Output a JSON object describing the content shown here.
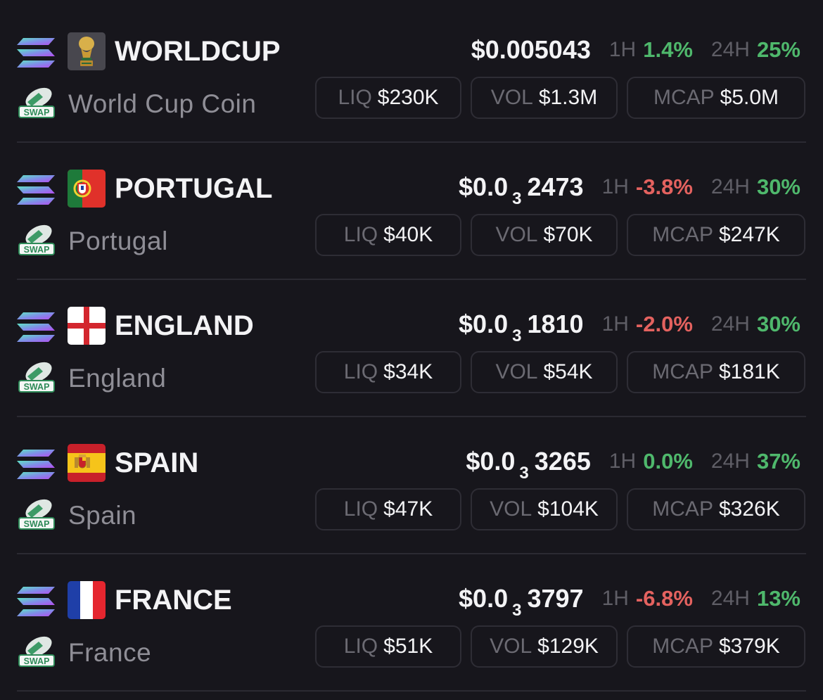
{
  "tokens": [
    {
      "symbol": "WORLDCUP",
      "name": "World Cup Coin",
      "flag": "trophy-icon",
      "price_prefix": "$0.005043",
      "price_zeros": "",
      "price_digits": "",
      "h1_label": "1H",
      "h1": "1.4%",
      "h1_dir": "up",
      "h24_label": "24H",
      "h24": "25%",
      "h24_dir": "up",
      "liq_label": "LIQ",
      "liq": "$230K",
      "vol_label": "VOL",
      "vol": "$1.3M",
      "mcap_label": "MCAP",
      "mcap": "$5.0M"
    },
    {
      "symbol": "PORTUGAL",
      "name": "Portugal",
      "flag": "portugal-flag-icon",
      "price_prefix": "$0.0",
      "price_zeros": "3",
      "price_digits": "2473",
      "h1_label": "1H",
      "h1": "-3.8%",
      "h1_dir": "down",
      "h24_label": "24H",
      "h24": "30%",
      "h24_dir": "up",
      "liq_label": "LIQ",
      "liq": "$40K",
      "vol_label": "VOL",
      "vol": "$70K",
      "mcap_label": "MCAP",
      "mcap": "$247K"
    },
    {
      "symbol": "ENGLAND",
      "name": "England",
      "flag": "england-flag-icon",
      "price_prefix": "$0.0",
      "price_zeros": "3",
      "price_digits": "1810",
      "h1_label": "1H",
      "h1": "-2.0%",
      "h1_dir": "down",
      "h24_label": "24H",
      "h24": "30%",
      "h24_dir": "up",
      "liq_label": "LIQ",
      "liq": "$34K",
      "vol_label": "VOL",
      "vol": "$54K",
      "mcap_label": "MCAP",
      "mcap": "$181K"
    },
    {
      "symbol": "SPAIN",
      "name": "Spain",
      "flag": "spain-flag-icon",
      "price_prefix": "$0.0",
      "price_zeros": "3",
      "price_digits": "3265",
      "h1_label": "1H",
      "h1": "0.0%",
      "h1_dir": "up",
      "h24_label": "24H",
      "h24": "37%",
      "h24_dir": "up",
      "liq_label": "LIQ",
      "liq": "$47K",
      "vol_label": "VOL",
      "vol": "$104K",
      "mcap_label": "MCAP",
      "mcap": "$326K"
    },
    {
      "symbol": "FRANCE",
      "name": "France",
      "flag": "france-flag-icon",
      "price_prefix": "$0.0",
      "price_zeros": "3",
      "price_digits": "3797",
      "h1_label": "1H",
      "h1": "-6.8%",
      "h1_dir": "down",
      "h24_label": "24H",
      "h24": "13%",
      "h24_dir": "up",
      "liq_label": "LIQ",
      "liq": "$51K",
      "vol_label": "VOL",
      "vol": "$129K",
      "mcap_label": "MCAP",
      "mcap": "$379K"
    }
  ],
  "swap_badge_label": "SWAP",
  "chain_icon": "solana-icon",
  "colors": {
    "up": "#4fb86c",
    "down": "#e4625f",
    "background": "#17161c"
  }
}
